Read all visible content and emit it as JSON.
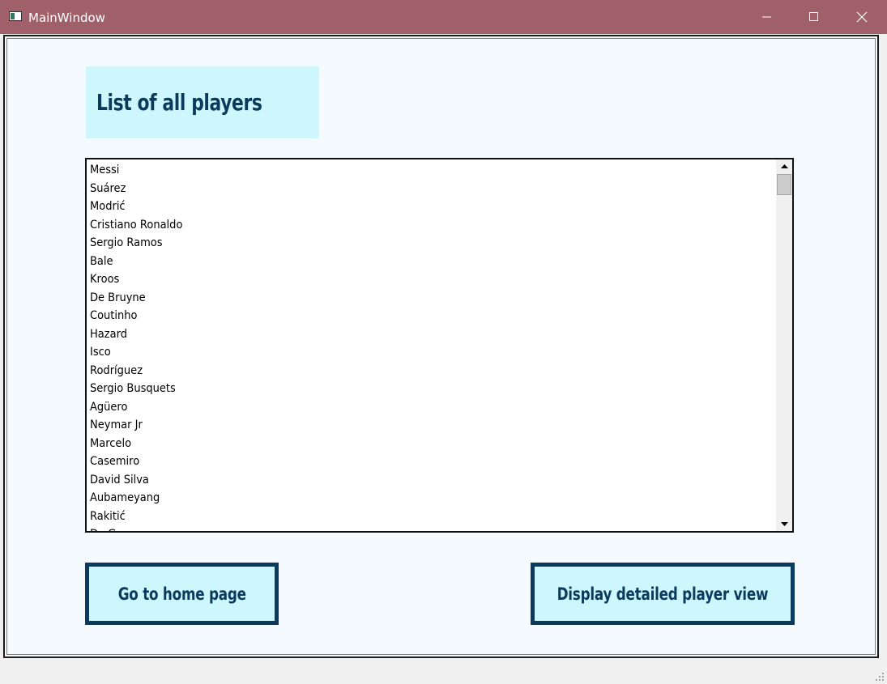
{
  "window": {
    "title": "MainWindow"
  },
  "titlebar": {
    "minimize_icon": "minimize-icon",
    "maximize_icon": "maximize-icon",
    "close_icon": "close-icon"
  },
  "heading": "List of all players",
  "players": [
    "Messi",
    "Suárez",
    "Modrić",
    "Cristiano Ronaldo",
    "Sergio Ramos",
    "Bale",
    "Kroos",
    "De Bruyne",
    "Coutinho",
    "Hazard",
    "Isco",
    "Rodríguez",
    "Sergio Busquets",
    "Agüero",
    "Neymar Jr",
    "Marcelo",
    "Casemiro",
    "David Silva",
    "Aubameyang",
    "Rakitić",
    "De Gea"
  ],
  "buttons": {
    "home": "Go to home page",
    "detail": "Display detailed player view"
  },
  "colors": {
    "titlebar": "#a0606a",
    "accent_dark": "#0a3a5e",
    "accent_light": "#cef7fd",
    "client_bg": "#f4fafe"
  }
}
